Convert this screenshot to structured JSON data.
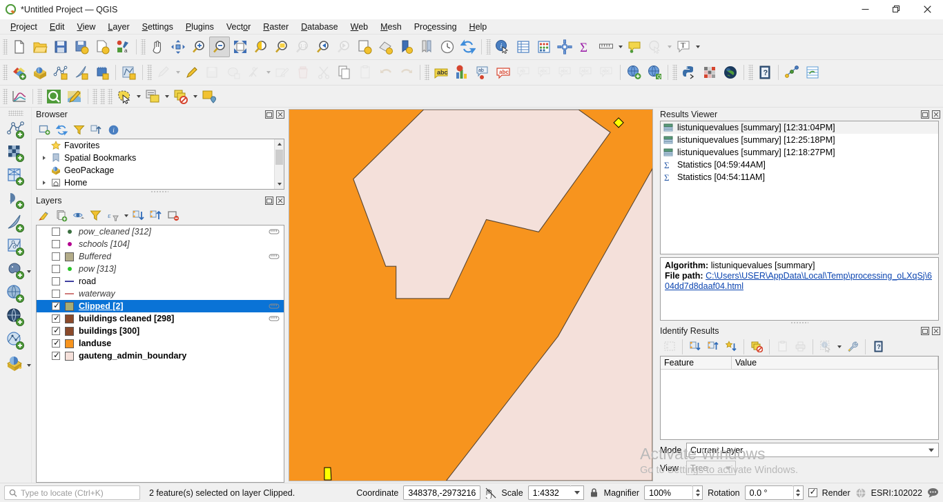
{
  "window": {
    "title": "*Untitled Project — QGIS",
    "app_icon": "qgis-logo-icon",
    "minimize": "—",
    "maximize": "❐",
    "close": "✕"
  },
  "menubar": {
    "items": [
      {
        "label": "Project",
        "mnemonic": "P"
      },
      {
        "label": "Edit",
        "mnemonic": "E"
      },
      {
        "label": "View",
        "mnemonic": "V"
      },
      {
        "label": "Layer",
        "mnemonic": "L"
      },
      {
        "label": "Settings",
        "mnemonic": "S"
      },
      {
        "label": "Plugins",
        "mnemonic": "P"
      },
      {
        "label": "Vector",
        "mnemonic": "o"
      },
      {
        "label": "Raster",
        "mnemonic": "R"
      },
      {
        "label": "Database",
        "mnemonic": "D"
      },
      {
        "label": "Web",
        "mnemonic": "W"
      },
      {
        "label": "Mesh",
        "mnemonic": "M"
      },
      {
        "label": "Processing",
        "mnemonic": "c"
      },
      {
        "label": "Help",
        "mnemonic": "H"
      }
    ]
  },
  "toolbars": {
    "row1": [
      {
        "icon": "new-project-icon",
        "tooltip": "New Project"
      },
      {
        "icon": "open-project-icon",
        "tooltip": "Open Project"
      },
      {
        "icon": "save-project-icon",
        "tooltip": "Save Project"
      },
      {
        "icon": "save-project-as-icon",
        "tooltip": "Save Project As"
      },
      {
        "icon": "new-print-layout-icon",
        "tooltip": "New Print Layout"
      },
      {
        "icon": "style-manager-icon",
        "tooltip": "Style Manager"
      },
      {
        "icon": "pan-map-icon",
        "tooltip": "Pan Map"
      },
      {
        "icon": "pan-to-selection-icon",
        "tooltip": "Pan Map to Selection"
      },
      {
        "icon": "zoom-in-icon",
        "tooltip": "Zoom In"
      },
      {
        "icon": "zoom-out-icon",
        "tooltip": "Zoom Out",
        "state": "pressed"
      },
      {
        "icon": "zoom-full-icon",
        "tooltip": "Zoom Full"
      },
      {
        "icon": "zoom-selection-icon",
        "tooltip": "Zoom to Selection"
      },
      {
        "icon": "zoom-layer-icon",
        "tooltip": "Zoom to Layer"
      },
      {
        "icon": "zoom-native-icon",
        "tooltip": "Zoom to Native Resolution",
        "state": "disabled"
      },
      {
        "icon": "zoom-last-icon",
        "tooltip": "Zoom Last"
      },
      {
        "icon": "zoom-next-icon",
        "tooltip": "Zoom Next",
        "state": "disabled"
      },
      {
        "icon": "new-map-view-icon",
        "tooltip": "New Map View"
      },
      {
        "icon": "new-3d-map-view-icon",
        "tooltip": "New 3D Map View"
      },
      {
        "icon": "show-bookmarks-icon",
        "tooltip": "Show Bookmarks"
      },
      {
        "icon": "new-bookmark-icon",
        "tooltip": "New Bookmark"
      },
      {
        "icon": "temporal-controller-icon",
        "tooltip": "Temporal Controller Panel"
      },
      {
        "icon": "refresh-icon",
        "tooltip": "Refresh"
      },
      {
        "icon": "identify-features-icon",
        "tooltip": "Identify Features"
      },
      {
        "icon": "open-attribute-table-icon",
        "tooltip": "Open Attribute Table"
      },
      {
        "icon": "field-calculator-icon",
        "tooltip": "Field Calculator"
      },
      {
        "icon": "processing-toolbox-icon",
        "tooltip": "Processing Toolbox"
      },
      {
        "icon": "statistical-summary-icon",
        "tooltip": "Statistical Summary"
      },
      {
        "icon": "measure-line-icon",
        "tooltip": "Measure Line",
        "dropdown": true
      },
      {
        "icon": "map-tips-icon",
        "tooltip": "Show Map Tips"
      },
      {
        "icon": "deselect-features-icon",
        "tooltip": "Deselect Features",
        "state": "disabled",
        "dropdown": true
      },
      {
        "icon": "text-annotation-icon",
        "tooltip": "Text Annotation",
        "dropdown": true
      }
    ],
    "row2": [
      {
        "icon": "add-layer-icon",
        "tooltip": "Data Source Manager"
      },
      {
        "icon": "add-geopackage-layer-icon",
        "tooltip": "Add GeoPackage Layer"
      },
      {
        "icon": "new-vector-layer-icon",
        "tooltip": "New Vector Layer"
      },
      {
        "icon": "new-scratch-layer-icon",
        "tooltip": "New Scratch Layer"
      },
      {
        "icon": "new-memory-layer-icon",
        "tooltip": "New Mesh Layer"
      },
      {
        "icon": "new-shapefile-layer-icon",
        "tooltip": "New Shapefile Layer"
      },
      {
        "icon": "current-edits-icon",
        "tooltip": "Current Edits",
        "state": "disabled",
        "dropdown": true
      },
      {
        "icon": "toggle-editing-icon",
        "tooltip": "Toggle Editing"
      },
      {
        "icon": "save-layer-edits-icon",
        "tooltip": "Save Layer Edits",
        "state": "disabled"
      },
      {
        "icon": "add-polygon-feature-icon",
        "tooltip": "Add Polygon Feature",
        "state": "disabled"
      },
      {
        "icon": "vertex-tool-icon",
        "tooltip": "Vertex Tool",
        "state": "disabled",
        "dropdown": true
      },
      {
        "icon": "modify-attributes-icon",
        "tooltip": "Modify Attributes of Selected Features",
        "state": "disabled"
      },
      {
        "icon": "delete-selected-icon",
        "tooltip": "Delete Selected",
        "state": "disabled"
      },
      {
        "icon": "cut-features-icon",
        "tooltip": "Cut Features",
        "state": "disabled"
      },
      {
        "icon": "copy-features-icon",
        "tooltip": "Copy Features"
      },
      {
        "icon": "paste-features-icon",
        "tooltip": "Paste Features",
        "state": "disabled"
      },
      {
        "icon": "undo-icon",
        "tooltip": "Undo",
        "state": "disabled"
      },
      {
        "icon": "redo-icon",
        "tooltip": "Redo",
        "state": "disabled"
      },
      {
        "icon": "label-abc-icon",
        "tooltip": "Layer Labeling Options"
      },
      {
        "icon": "diagram-icon",
        "tooltip": "Layer Diagram Options"
      },
      {
        "icon": "highlight-pinned-labels-icon",
        "tooltip": "Highlight Pinned Labels"
      },
      {
        "icon": "show-hide-labels-icon",
        "tooltip": "Show/Hide Labels"
      },
      {
        "icon": "pin-labels-icon",
        "tooltip": "Pin/Unpin Labels",
        "state": "disabled"
      },
      {
        "icon": "show-unplaced-labels-icon",
        "tooltip": "Show Unplaced Labels",
        "state": "disabled"
      },
      {
        "icon": "move-label-icon",
        "tooltip": "Move Label",
        "state": "disabled"
      },
      {
        "icon": "rotate-label-icon",
        "tooltip": "Rotate Label",
        "state": "disabled"
      },
      {
        "icon": "change-label-icon",
        "tooltip": "Change Label",
        "state": "disabled"
      },
      {
        "icon": "metasearch-add-icon",
        "tooltip": "MetaSearch"
      },
      {
        "icon": "metasearch-find-icon",
        "tooltip": "MetaSearch Catalogue"
      },
      {
        "icon": "python-console-icon",
        "tooltip": "Python Console"
      },
      {
        "icon": "plugin-manager-icon",
        "tooltip": "Plugin Manager"
      },
      {
        "icon": "globe-plugin-icon",
        "tooltip": "Globe"
      },
      {
        "icon": "help-contents-icon",
        "tooltip": "Help Contents"
      },
      {
        "icon": "qgis-cloud-icon",
        "tooltip": "QGIS Cloud"
      },
      {
        "icon": "attribute-sync-icon",
        "tooltip": "Attribute Table Sync"
      }
    ],
    "row3": [
      {
        "icon": "data-plotly-icon",
        "tooltip": "DataPlotly"
      },
      {
        "icon": "qfield-sync-icon",
        "tooltip": "QField Sync"
      },
      {
        "icon": "map-edit-icon",
        "tooltip": "Map Edit"
      },
      {
        "icon": "select-features-icon",
        "tooltip": "Select Features by Area",
        "dropdown": true
      },
      {
        "icon": "select-by-form-icon",
        "tooltip": "Select Features by Expression",
        "dropdown": true
      },
      {
        "icon": "deselect-all-icon",
        "tooltip": "Deselect Features from All Layers",
        "dropdown": true
      },
      {
        "icon": "select-value-icon",
        "tooltip": "Select Value"
      }
    ]
  },
  "vertical_toolbar": {
    "items": [
      {
        "icon": "add-vector-layer-icon",
        "tooltip": "Add Vector Layer"
      },
      {
        "icon": "add-raster-layer-icon",
        "tooltip": "Add Raster Layer"
      },
      {
        "icon": "add-mesh-layer-icon",
        "tooltip": "Add Mesh Layer"
      },
      {
        "icon": "add-delimited-text-layer-icon",
        "tooltip": "Add Delimited Text Layer"
      },
      {
        "icon": "add-spatialite-layer-icon",
        "tooltip": "Add SpatiaLite Layer"
      },
      {
        "icon": "add-vector-tile-layer-icon",
        "tooltip": "Add Vector Tile Layer"
      },
      {
        "icon": "add-postgis-layer-icon",
        "tooltip": "Add PostGIS Layer",
        "dropdown": true
      },
      {
        "icon": "add-wms-layer-icon",
        "tooltip": "Add WMS/WMTS Layer"
      },
      {
        "icon": "add-wfs-layer-icon",
        "tooltip": "Add WFS Layer"
      },
      {
        "icon": "add-wcs-layer-icon",
        "tooltip": "Add WCS Layer"
      },
      {
        "icon": "add-xyz-layer-icon",
        "tooltip": "Add XYZ Layer",
        "dropdown": true
      }
    ]
  },
  "browser_panel": {
    "title": "Browser",
    "float_btn": "undock-icon",
    "close_btn": "close-icon",
    "toolbar": [
      {
        "icon": "add-selected-layers-icon",
        "tooltip": "Add Selected Layers"
      },
      {
        "icon": "refresh-icon",
        "tooltip": "Refresh"
      },
      {
        "icon": "filter-browser-icon",
        "tooltip": "Filter Browser"
      },
      {
        "icon": "collapse-all-icon",
        "tooltip": "Collapse All"
      },
      {
        "icon": "show-properties-icon",
        "tooltip": "Enable/disable properties widget"
      }
    ],
    "items": [
      {
        "label": "Favorites",
        "icon": "star-icon",
        "expandable": false
      },
      {
        "label": "Spatial Bookmarks",
        "icon": "bookmark-icon",
        "expandable": true
      },
      {
        "label": "GeoPackage",
        "icon": "geopackage-icon",
        "expandable": false
      },
      {
        "label": "Home",
        "icon": "home-icon",
        "expandable": true
      }
    ]
  },
  "layers_panel": {
    "title": "Layers",
    "float_btn": "undock-icon",
    "close_btn": "close-icon",
    "toolbar": [
      {
        "icon": "open-layer-styling-icon",
        "tooltip": "Open the Layer Styling panel"
      },
      {
        "icon": "add-group-icon",
        "tooltip": "Add Group"
      },
      {
        "icon": "manage-map-themes-icon",
        "tooltip": "Manage Map Themes"
      },
      {
        "icon": "filter-legend-icon",
        "tooltip": "Filter Legend"
      },
      {
        "icon": "expression-filter-icon",
        "tooltip": "Filter Legend by Expression",
        "dropdown": true
      },
      {
        "icon": "expand-all-icon",
        "tooltip": "Expand All"
      },
      {
        "icon": "collapse-all-icon",
        "tooltip": "Collapse All"
      },
      {
        "icon": "remove-layer-icon",
        "tooltip": "Remove Layer/Group"
      }
    ],
    "layers": [
      {
        "name": "pow_cleaned [312]",
        "checked": false,
        "style": "italic",
        "symbol": "point",
        "color": "#3b7040",
        "editable_badge": true
      },
      {
        "name": "schools [104]",
        "checked": false,
        "style": "italic",
        "symbol": "point",
        "color": "#b3008f",
        "editable_badge": false
      },
      {
        "name": "Buffered",
        "checked": false,
        "style": "italic",
        "symbol": "fill",
        "color": "#b3ac89",
        "editable_badge": true
      },
      {
        "name": "pow [313]",
        "checked": false,
        "style": "italic",
        "symbol": "point",
        "color": "#28c228",
        "editable_badge": false
      },
      {
        "name": "road",
        "checked": false,
        "style": "normal",
        "symbol": "line",
        "color": "#4040a0",
        "editable_badge": false
      },
      {
        "name": "waterway",
        "checked": false,
        "style": "italic",
        "symbol": "line",
        "color": "#cf7a7a",
        "editable_badge": false
      },
      {
        "name": "Clipped [2]",
        "checked": true,
        "style": "selected",
        "symbol": "fill",
        "color": "#a6ac74",
        "editable_badge": true
      },
      {
        "name": "buildings cleaned [298]",
        "checked": true,
        "style": "bold",
        "symbol": "fill",
        "color": "#8b4a2b",
        "editable_badge": true
      },
      {
        "name": "buildings [300]",
        "checked": true,
        "style": "bold",
        "symbol": "fill",
        "color": "#8b4a2b",
        "editable_badge": false
      },
      {
        "name": "landuse",
        "checked": true,
        "style": "bold",
        "symbol": "fill",
        "color": "#f7941e",
        "editable_badge": false
      },
      {
        "name": "gauteng_admin_boundary",
        "checked": true,
        "style": "bold",
        "symbol": "fill",
        "color": "#f5e0da",
        "editable_badge": false
      }
    ]
  },
  "map": {
    "background_color": "#f7941e",
    "boundary_fill": "#f4e0da",
    "boundary_stroke": "#5a4632",
    "selected_fill": "#ffff00",
    "selected_stroke": "#000000",
    "selected_feature_count": 2
  },
  "results_viewer": {
    "title": "Results Viewer",
    "float_btn": "undock-icon",
    "close_btn": "close-icon",
    "items": [
      {
        "label": "listuniquevalues [summary] [12:31:04PM]",
        "icon": "html-result-icon",
        "selected": true
      },
      {
        "label": "listuniquevalues [summary] [12:25:18PM]",
        "icon": "html-result-icon",
        "selected": false
      },
      {
        "label": "listuniquevalues [summary] [12:18:27PM]",
        "icon": "html-result-icon",
        "selected": false
      },
      {
        "label": "Statistics [04:59:44AM]",
        "icon": "sigma-icon",
        "selected": false
      },
      {
        "label": "Statistics [04:54:11AM]",
        "icon": "sigma-icon",
        "selected": false
      }
    ],
    "detail": {
      "algorithm_label": "Algorithm",
      "algorithm_value": "listuniquevalues [summary]",
      "filepath_label": "File path",
      "filepath_value": "C:\\Users\\USER\\AppData\\Local\\Temp\\processing_oLXqSj\\604dd7d8daaf04.html"
    }
  },
  "identify_results": {
    "title": "Identify Results",
    "float_btn": "undock-icon",
    "close_btn": "close-icon",
    "toolbar": [
      {
        "icon": "expand-tree-icon",
        "tooltip": "Expand tree",
        "state": "disabled"
      },
      {
        "icon": "expand-new-results-icon",
        "tooltip": "Expand new results by default"
      },
      {
        "icon": "collapse-all-icon",
        "tooltip": "Collapse All"
      },
      {
        "icon": "highlight-all-icon",
        "tooltip": "Highlight All"
      },
      {
        "icon": "clear-results-icon",
        "tooltip": "Clear Results"
      },
      {
        "icon": "copy-to-clipboard-icon",
        "tooltip": "Copy to clipboard",
        "state": "disabled"
      },
      {
        "icon": "print-icon",
        "tooltip": "Print",
        "state": "disabled"
      },
      {
        "icon": "identify-mode-icon",
        "tooltip": "Identify Feature(s)",
        "state": "disabled",
        "dropdown": true
      },
      {
        "icon": "options-wrench-icon",
        "tooltip": "Options"
      },
      {
        "icon": "help-icon",
        "tooltip": "Help"
      }
    ],
    "columns": [
      "Feature",
      "Value"
    ],
    "rows": [],
    "mode_label": "Mode",
    "mode_value": "Current Layer",
    "view_label": "View",
    "view_value": "Tree"
  },
  "watermark": {
    "line1": "Activate Windows",
    "line2": "Go to Settings to activate Windows."
  },
  "statusbar": {
    "locate_placeholder": "Type to locate (Ctrl+K)",
    "locate_icon": "search-icon",
    "message": "2 feature(s) selected on layer Clipped.",
    "coordinate_label": "Coordinate",
    "coordinate_value": "348378,-2973216",
    "coordinate_toggle_icon": "toggle-extents-icon",
    "scale_label": "Scale",
    "scale_value": "1:4332",
    "lock_icon": "lock-icon",
    "magnifier_label": "Magnifier",
    "magnifier_value": "100%",
    "rotation_label": "Rotation",
    "rotation_value": "0.0 °",
    "render_label": "Render",
    "render_checked": true,
    "crs_icon": "crs-globe-icon",
    "crs_value": "ESRI:102022",
    "messages_icon": "messages-icon"
  }
}
